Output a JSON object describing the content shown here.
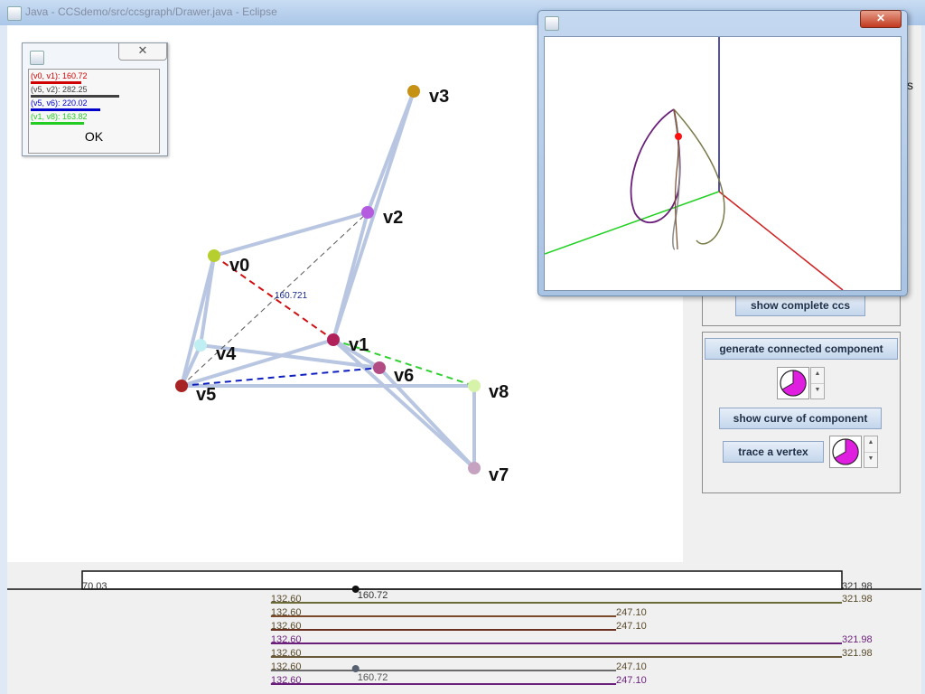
{
  "window": {
    "title": "Java - CCSdemo/src/ccsgraph/Drawer.java - Eclipse",
    "partial_right_text": "s"
  },
  "graph": {
    "vertices": [
      {
        "id": "v0",
        "label": "v0",
        "color": "#b6cf2f"
      },
      {
        "id": "v1",
        "label": "v1",
        "color": "#b0215a"
      },
      {
        "id": "v2",
        "label": "v2",
        "color": "#b45be0"
      },
      {
        "id": "v3",
        "label": "v3",
        "color": "#c59213"
      },
      {
        "id": "v4",
        "label": "v4",
        "color": "#bfeff3"
      },
      {
        "id": "v5",
        "label": "v5",
        "color": "#a82323"
      },
      {
        "id": "v6",
        "label": "v6",
        "color": "#b24b84"
      },
      {
        "id": "v7",
        "label": "v7",
        "color": "#c5a2c0"
      },
      {
        "id": "v8",
        "label": "v8",
        "color": "#d6f3a9"
      }
    ],
    "edge_label": "160.721"
  },
  "legend": {
    "rows": [
      {
        "text": "(v0, v1):  160.72",
        "color": "#d00000",
        "bar_fraction": 0.4
      },
      {
        "text": "(v5, v2):  282.25",
        "color": "#404040",
        "bar_fraction": 0.7
      },
      {
        "text": "(v5, v6):  220.02",
        "color": "#0000cc",
        "bar_fraction": 0.55
      },
      {
        "text": "(v1, v8):  163.82",
        "color": "#22cc22",
        "bar_fraction": 0.42
      }
    ],
    "ok_label": "OK"
  },
  "controls": {
    "show_complete_label": "show complete ccs",
    "generate_label": "generate connected component",
    "show_curve_label": "show curve of component",
    "trace_label": "trace a vertex",
    "spinner_up": "▲",
    "spinner_down": "▼"
  },
  "timeline": {
    "range_min": "70.03",
    "range_max": "321.98",
    "marker_value": "160.72",
    "bars": [
      {
        "start": "132.60",
        "end": "321.98",
        "color": "#6b6b3a"
      },
      {
        "start": "132.60",
        "end": "247.10",
        "color": "#7a4a2a"
      },
      {
        "start": "132.60",
        "end": "247.10",
        "color": "#6b2f1f"
      },
      {
        "start": "132.60",
        "end": "321.98",
        "color": "#6a1f7a",
        "purple": true
      },
      {
        "start": "132.60",
        "end": "321.98",
        "color": "#6b5a3a"
      },
      {
        "start": "132.60",
        "end": "247.10",
        "color": "#6b6b6b",
        "marker": "160.72"
      },
      {
        "start": "132.60",
        "end": "247.10",
        "color": "#6a1f7a",
        "purple": true
      }
    ]
  }
}
